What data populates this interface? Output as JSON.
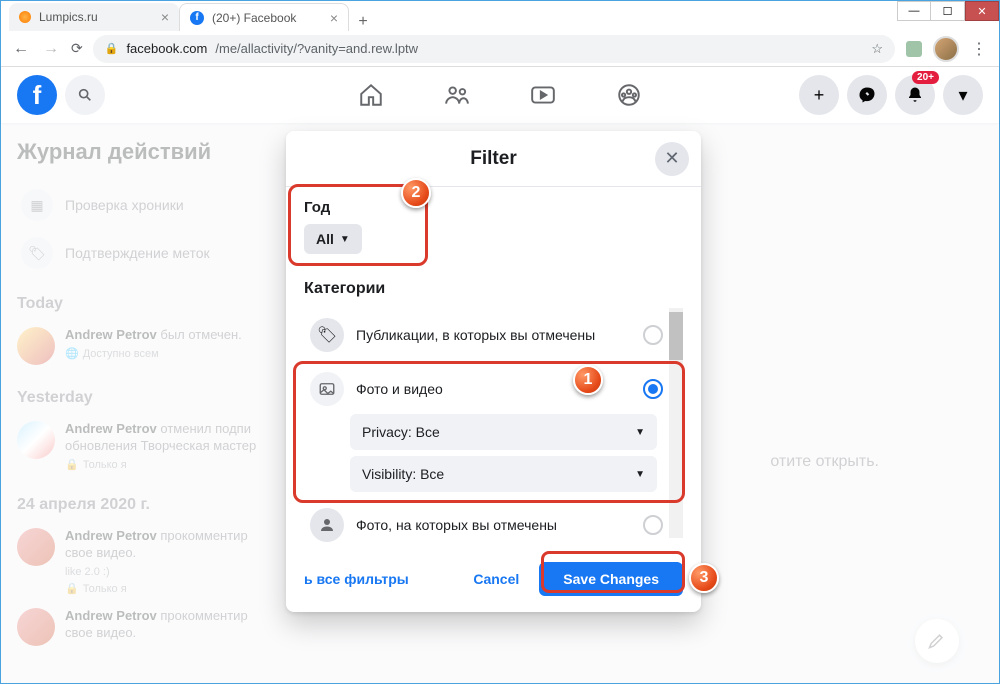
{
  "window": {
    "tabs": [
      {
        "title": "Lumpics.ru"
      },
      {
        "title": "(20+) Facebook"
      }
    ]
  },
  "addressbar": {
    "host": "facebook.com",
    "path": "/me/allactivity/?vanity=and.rew.lptw"
  },
  "fb_header": {
    "notif_count": "20+"
  },
  "sidebar": {
    "title": "Журнал действий",
    "items": [
      {
        "label": "Проверка хроники"
      },
      {
        "label": "Подтверждение меток"
      }
    ],
    "sections": [
      {
        "heading": "Today",
        "items": [
          {
            "name": "Andrew Petrov",
            "action": "был отмечен.",
            "privacy": "Доступно всем"
          }
        ]
      },
      {
        "heading": "Yesterday",
        "items": [
          {
            "name": "Andrew Petrov",
            "action": "отменил подпи",
            "line2": "обновления Творческая мастер",
            "privacy": "Только я"
          }
        ]
      },
      {
        "heading": "24 апреля 2020 г.",
        "items": [
          {
            "name": "Andrew Petrov",
            "action": "прокомментир",
            "line2": "свое видео.",
            "sub": "like 2.0 :)",
            "privacy": "Только я"
          },
          {
            "name": "Andrew Petrov",
            "action": "прокомментир",
            "line2": "свое видео."
          }
        ]
      }
    ]
  },
  "bg_right": "отите открыть.",
  "modal": {
    "title": "Filter",
    "year_label": "Год",
    "year_value": "All",
    "categories_label": "Категории",
    "categories": [
      {
        "label": "Публикации, в которых вы отмечены",
        "selected": false
      },
      {
        "label": "Фото и видео",
        "selected": true
      },
      {
        "label": "Фото, на которых вы отмечены",
        "selected": false
      }
    ],
    "privacy_select": "Privacy: Все",
    "visibility_select": "Visibility: Все",
    "clear_link": "ь все фильтры",
    "cancel": "Cancel",
    "save": "Save Changes"
  },
  "annotations": {
    "n1": "1",
    "n2": "2",
    "n3": "3"
  }
}
